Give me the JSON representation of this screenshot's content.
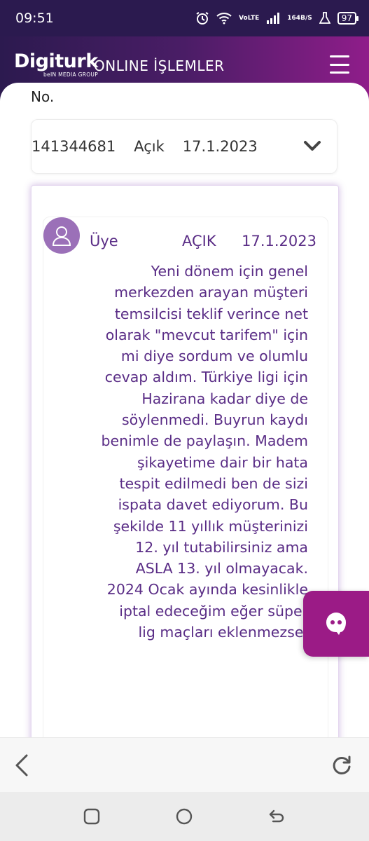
{
  "status_bar": {
    "time": "09:51",
    "network_label_top": "Vo",
    "network_label_bottom": "LTE",
    "speed_value": "164",
    "speed_unit": "B/S",
    "battery": "97",
    "icons": [
      "alarm-icon",
      "wifi-icon",
      "signal-icon",
      "flask-icon",
      "battery-icon"
    ]
  },
  "header": {
    "logo_text": "Digiturk",
    "logo_subtext": "beIN MEDIA GROUP",
    "title": "ONLINE İŞLEMLER",
    "menu_icon": "hamburger-menu-icon"
  },
  "ticket_list": {
    "column_label": "No.",
    "row": {
      "number": "141344681",
      "status": "Açık",
      "date": "17.1.2023",
      "expand_icon": "chevron-down-icon"
    }
  },
  "message": {
    "avatar_icon": "user-avatar-icon",
    "sender": "Üye",
    "status": "AÇIK",
    "date": "17.1.2023",
    "text": "Yeni dönem için genel merkezden arayan müşteri temsilcisi teklif verince net olarak \"mevcut tarifem\" için mi diye sordum ve olumlu cevap aldım. Türkiye ligi için Hazirana kadar diye de söylenmedi. Buyrun kaydı benimle de paylaşın. Madem şikayetime dair bir hata tespit edilmedi ben de sizi ispata davet ediyorum. Bu şekilde 11 yıllık müşterinizi 12. yıl tutabilirsiniz ama ASLA 13. yıl olmayacak. 2024 Ocak ayında kesinlikle iptal edeceğim eğer süper lig maçları eklenmezse."
  },
  "chat_fab": {
    "icon": "chat-ghost-icon",
    "color": "#9b1b86"
  },
  "browser_nav": {
    "back_icon": "back-arrow-icon",
    "reload_icon": "reload-icon"
  },
  "system_nav": {
    "recents_icon": "recents-icon",
    "home_icon": "home-icon",
    "back_icon": "system-back-icon"
  },
  "colors": {
    "accent": "#5a2d86",
    "header_start": "#2c1a4f",
    "header_end": "#8f1d8a",
    "avatar": "#9b70b8"
  }
}
